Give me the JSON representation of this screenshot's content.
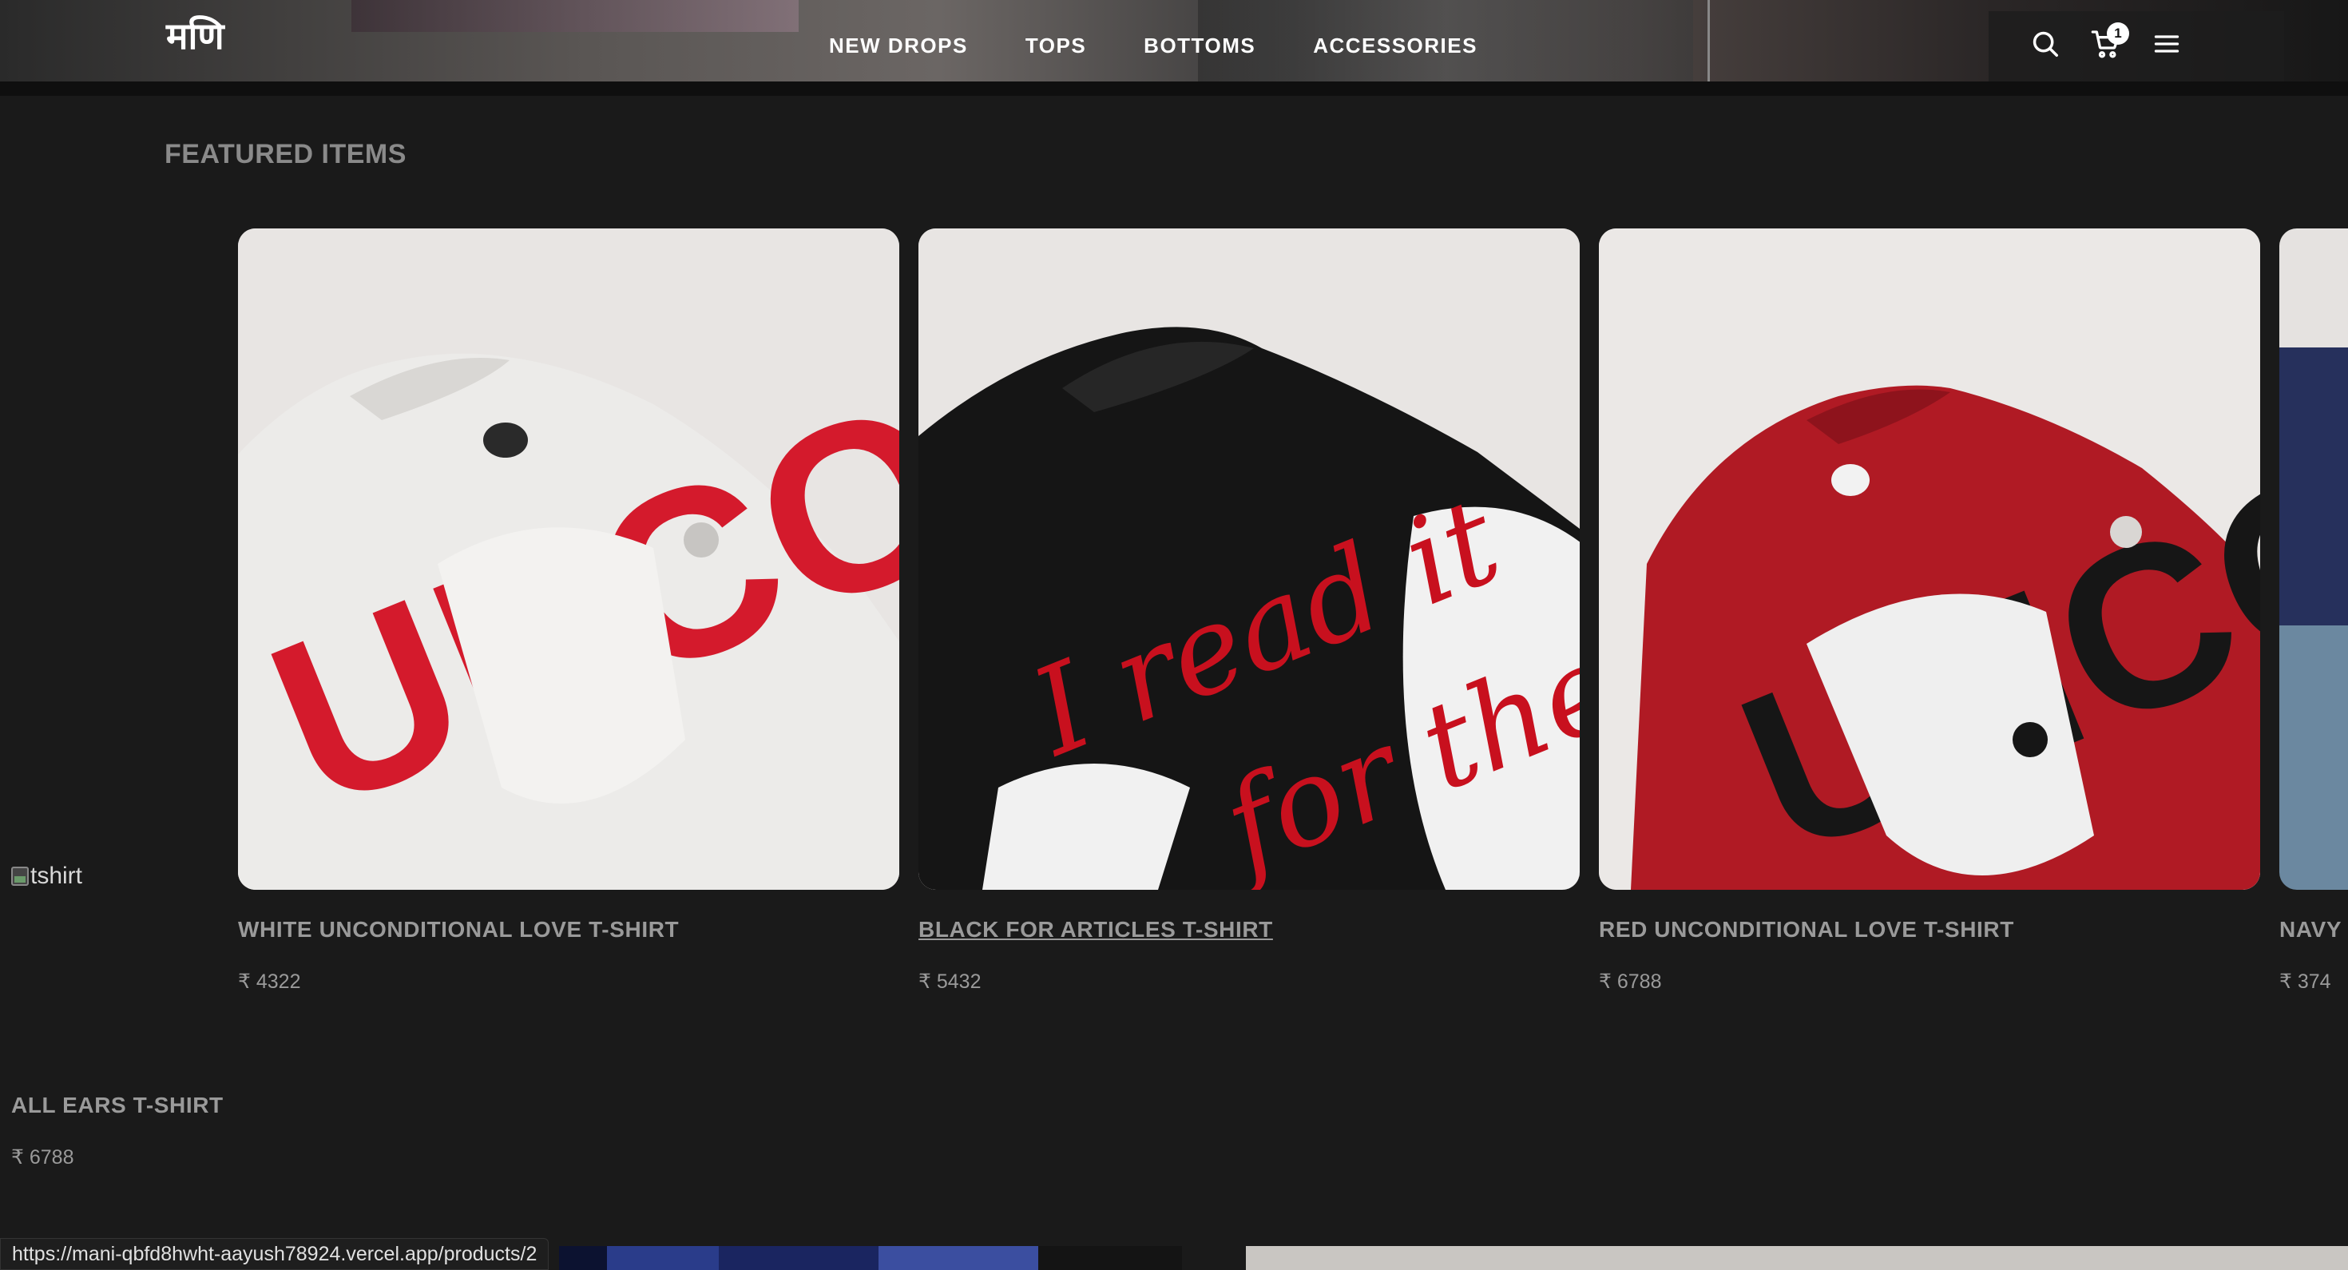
{
  "header": {
    "logo": "मणि",
    "nav": [
      "NEW DROPS",
      "TOPS",
      "BOTTOMS",
      "ACCESSORIES"
    ],
    "cart_count": "1",
    "icons": [
      "search-icon",
      "cart-icon",
      "menu-icon"
    ]
  },
  "section": {
    "title": "FEATURED ITEMS"
  },
  "broken_image_alt": "tshirt",
  "products": [
    {
      "name": "WHITE UNCONDITIONAL LOVE T-SHIRT",
      "price": "₹ 4322",
      "color": "#ecebe9"
    },
    {
      "name": "BLACK FOR ARTICLES T-SHIRT",
      "price": "₹ 5432",
      "color": "#151515"
    },
    {
      "name": "RED UNCONDITIONAL LOVE T-SHIRT",
      "price": "₹ 6788",
      "color": "#b01a24"
    },
    {
      "name": "NAVY",
      "price": "₹ 374",
      "color": "#26305c"
    }
  ],
  "extra_product": {
    "name": "ALL EARS T-SHIRT",
    "price": "₹ 6788"
  },
  "status_url": "https://mani-qbfd8hwht-aayush78924.vercel.app/products/2",
  "colors": {
    "background": "#1a1a1a",
    "muted_text": "#9a9a9a",
    "accent_red": "#d41a2c"
  }
}
